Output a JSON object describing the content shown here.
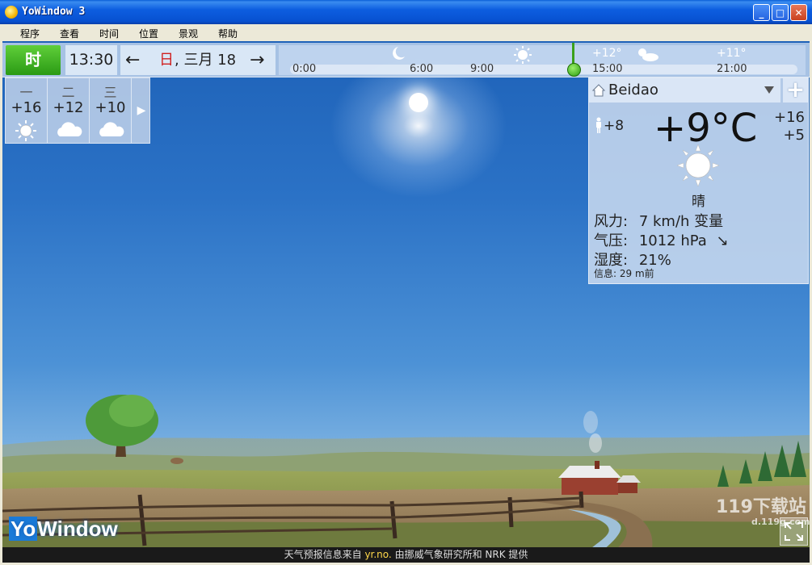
{
  "window": {
    "title": "YoWindow 3",
    "minimize_label": "_",
    "maximize_label": "□",
    "close_label": "✕"
  },
  "menu": {
    "items": [
      "程序",
      "查看",
      "时间",
      "位置",
      "景观",
      "帮助"
    ]
  },
  "topbar": {
    "now_label": "时",
    "time": "13:30",
    "prev_arrow": "←",
    "next_arrow": "→",
    "date_day": "日",
    "date_rest": ", 三月 18"
  },
  "timeline": {
    "labels": [
      "0:00",
      "6:00",
      "9:00",
      "15:00",
      "21:00"
    ],
    "temps": [
      "+12°",
      "+11°"
    ],
    "icons": [
      "moon-icon",
      "sun-icon",
      "partly-cloudy-icon"
    ]
  },
  "forecast": {
    "days": [
      {
        "name": "一",
        "temp": "+16",
        "icon": "sun-icon"
      },
      {
        "name": "二",
        "temp": "+12",
        "icon": "cloud-icon"
      },
      {
        "name": "三",
        "temp": "+10",
        "icon": "cloud-icon"
      }
    ],
    "next_label": "▶"
  },
  "panel": {
    "location": "Beidao",
    "add_label": "+",
    "feels_like": "+8",
    "temperature": "+9°C",
    "high": "+16",
    "low": "+5",
    "condition": "晴",
    "wind_label": "风力:",
    "wind_value": "7 km/h 变量",
    "pressure_label": "气压:",
    "pressure_value": "1012 hPa",
    "pressure_trend": "↘",
    "humidity_label": "湿度:",
    "humidity_value": "21%",
    "info": "信息:  29 m前"
  },
  "logo": {
    "yo": "Yo",
    "window": "Window"
  },
  "status": {
    "prefix": "天气预报信息来自 ",
    "link": "yr.no.",
    "suffix": " 由挪威气象研究所和 NRK 提供"
  },
  "watermark": {
    "main": "119下载站",
    "sub": "d.119g.com"
  },
  "colors": {
    "accent_green": "#2b9a14",
    "sky_top": "#1e62b8",
    "title_blue": "#0750d0"
  }
}
